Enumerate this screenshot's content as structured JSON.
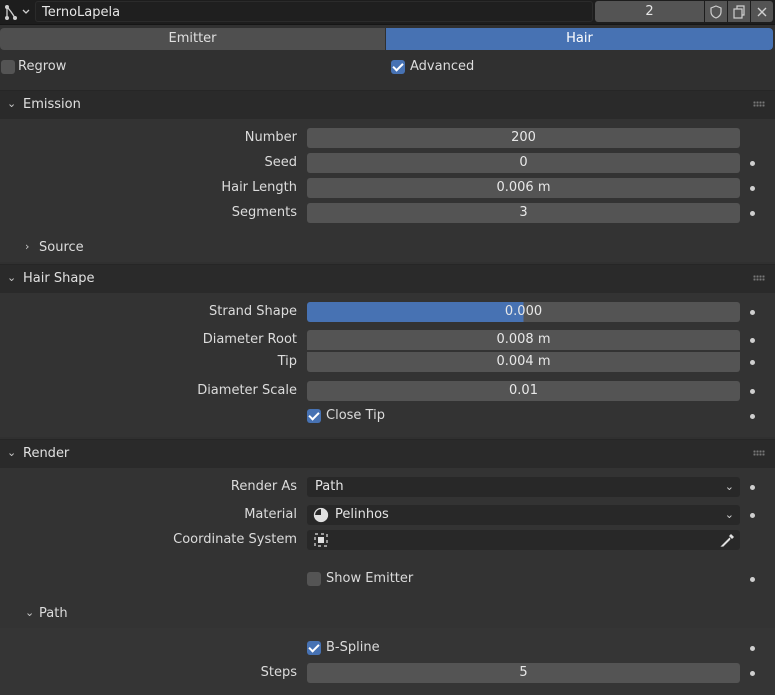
{
  "header": {
    "system_name": "TernoLapela",
    "users": "2"
  },
  "tabs": [
    {
      "label": "Emitter",
      "active": false
    },
    {
      "label": "Hair",
      "active": true
    }
  ],
  "options": {
    "regrow": {
      "label": "Regrow",
      "checked": false
    },
    "advanced": {
      "label": "Advanced",
      "checked": true
    }
  },
  "emission": {
    "title": "Emission",
    "number": {
      "label": "Number",
      "value": "200"
    },
    "seed": {
      "label": "Seed",
      "value": "0"
    },
    "hair_length": {
      "label": "Hair Length",
      "value": "0.006 m"
    },
    "segments": {
      "label": "Segments",
      "value": "3"
    },
    "source": {
      "label": "Source"
    }
  },
  "hair_shape": {
    "title": "Hair Shape",
    "strand_shape": {
      "label": "Strand Shape",
      "value": "0.000",
      "fill_fraction": 0.5
    },
    "diameter_root": {
      "label": "Diameter Root",
      "value": "0.008 m"
    },
    "tip": {
      "label": "Tip",
      "value": "0.004 m"
    },
    "diameter_scale": {
      "label": "Diameter Scale",
      "value": "0.01"
    },
    "close_tip": {
      "label": "Close Tip",
      "checked": true
    }
  },
  "render": {
    "title": "Render",
    "render_as": {
      "label": "Render As",
      "value": "Path"
    },
    "material": {
      "label": "Material",
      "value": "Pelinhos"
    },
    "coordinate_system": {
      "label": "Coordinate System",
      "value": ""
    },
    "show_emitter": {
      "label": "Show Emitter",
      "checked": false
    },
    "path": {
      "title": "Path",
      "b_spline": {
        "label": "B-Spline",
        "checked": true
      },
      "steps": {
        "label": "Steps",
        "value": "5"
      }
    }
  },
  "colors": {
    "accent": "#4772b3",
    "background": "#303030",
    "field": "#545454"
  }
}
